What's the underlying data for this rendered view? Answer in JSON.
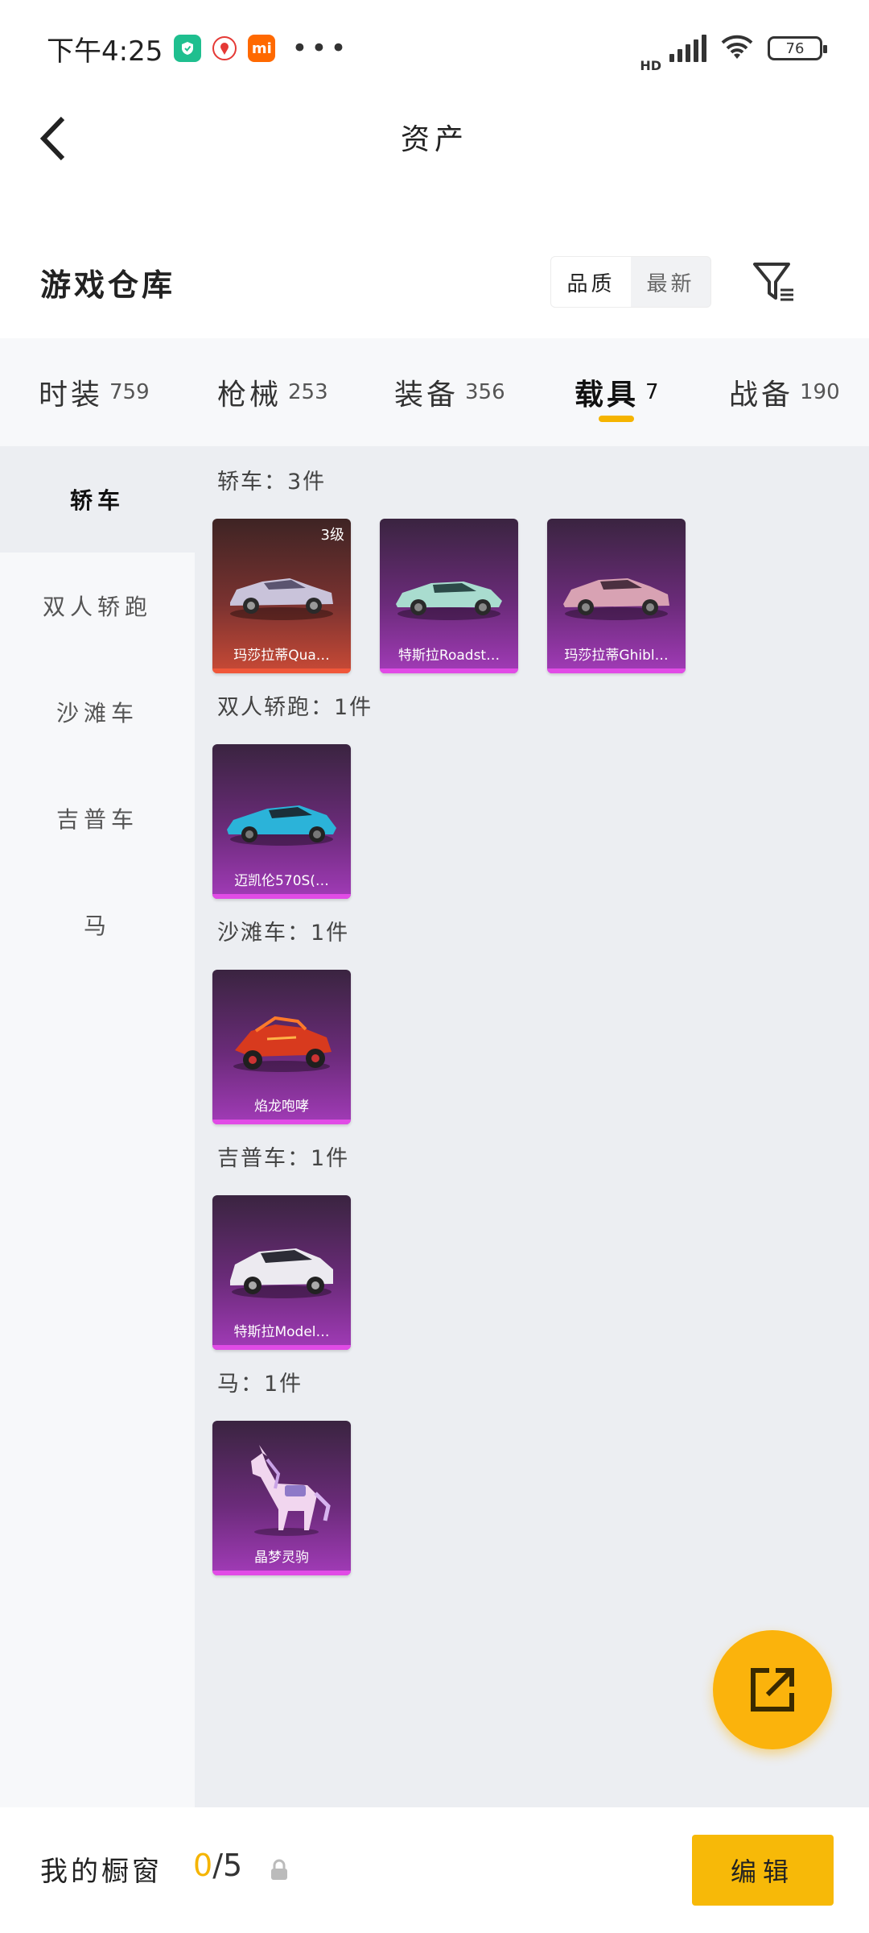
{
  "status_bar": {
    "time": "下午4:25",
    "icons": [
      "security-app-icon",
      "map-app-icon",
      "mi-app-icon"
    ],
    "more": "•••",
    "network": "HD",
    "battery": "76"
  },
  "header": {
    "title": "资产"
  },
  "warehouse": {
    "title": "游戏仓库",
    "sort_options": [
      "品质",
      "最新"
    ],
    "active_sort": "最新"
  },
  "tabs": [
    {
      "label": "时装",
      "count": "759"
    },
    {
      "label": "枪械",
      "count": "253"
    },
    {
      "label": "装备",
      "count": "356"
    },
    {
      "label": "载具",
      "count": "7"
    },
    {
      "label": "战备",
      "count": "190"
    }
  ],
  "active_tab": "载具",
  "sidebar": {
    "items": [
      "轿车",
      "双人轿跑",
      "沙滩车",
      "吉普车",
      "马"
    ],
    "active": "轿车"
  },
  "sections": [
    {
      "title": "轿车：3件",
      "items": [
        {
          "name": "玛莎拉蒂Qua…",
          "level": "3级",
          "rarity": "red"
        },
        {
          "name": "特斯拉Roadst…",
          "level": "",
          "rarity": "purple"
        },
        {
          "name": "玛莎拉蒂Ghibl…",
          "level": "",
          "rarity": "purple"
        }
      ]
    },
    {
      "title": "双人轿跑：1件",
      "items": [
        {
          "name": "迈凯伦570S(…",
          "level": "",
          "rarity": "purple"
        }
      ]
    },
    {
      "title": "沙滩车：1件",
      "items": [
        {
          "name": "焰龙咆哮",
          "level": "",
          "rarity": "purple"
        }
      ]
    },
    {
      "title": "吉普车：1件",
      "items": [
        {
          "name": "特斯拉Model…",
          "level": "",
          "rarity": "purple"
        }
      ]
    },
    {
      "title": "马：1件",
      "items": [
        {
          "name": "晶梦灵驹",
          "level": "",
          "rarity": "purple"
        }
      ]
    }
  ],
  "bottom_bar": {
    "label": "我的橱窗",
    "count_current": "0",
    "count_total": "/5",
    "edit_label": "编辑"
  },
  "colors": {
    "accent": "#f7b908",
    "rarity_purple": "#a23bb8",
    "rarity_red": "#c94a36"
  }
}
